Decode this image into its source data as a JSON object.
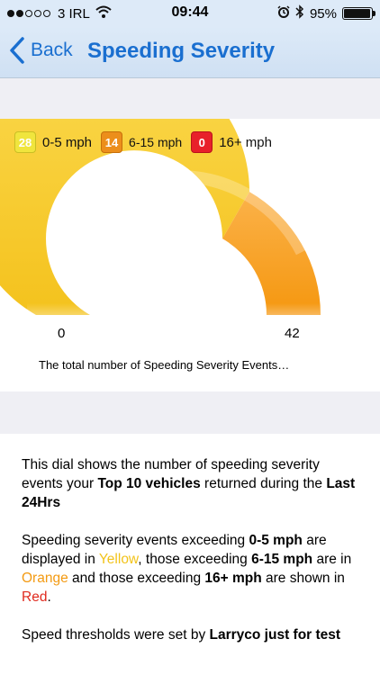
{
  "status_bar": {
    "carrier": "3 IRL",
    "time": "09:44",
    "battery": "95%",
    "battery_level": 0.95,
    "signal_bars_filled": 2,
    "signal_bars_total": 5
  },
  "nav": {
    "back_label": "Back",
    "title": "Speeding Severity"
  },
  "legend": [
    {
      "count": "28",
      "label": "0-5 mph",
      "color": "#f0e53d"
    },
    {
      "count": "14",
      "label": "6-15 mph",
      "color": "#ec8e1b"
    },
    {
      "count": "0",
      "label": "16+ mph",
      "color": "#e8202a"
    }
  ],
  "gauge": {
    "min": "0",
    "max": "42",
    "segments": [
      28,
      14,
      0
    ],
    "caption": "The total number of Speeding Severity Events…"
  },
  "info": {
    "p1_a": "This dial shows the number of speeding severity events your ",
    "p1_b": "Top 10 vehicles",
    "p1_c": " returned during the ",
    "p1_d": "Last 24Hrs",
    "p2_a": "Speeding severity events exceeding ",
    "p2_b": "0-5 mph",
    "p2_c": " are displayed in ",
    "p2_d": "Yellow",
    "p2_e": ", those exceeding ",
    "p2_f": "6-15 mph",
    "p2_g": " are in ",
    "p2_h": "Orange",
    "p2_i": " and those exceeding ",
    "p2_j": "16+ mph",
    "p2_k": " are shown in ",
    "p2_l": "Red",
    "p2_m": ".",
    "p3_a": "Speed thresholds were set by ",
    "p3_b": "Larryco just for test"
  }
}
